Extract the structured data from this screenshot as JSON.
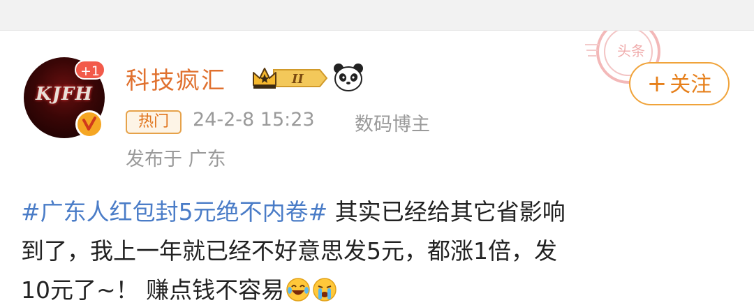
{
  "user": {
    "name": "科技疯汇",
    "avatar_text": "KJFH",
    "notification_badge": "+1",
    "level_badge": "II"
  },
  "follow_button": {
    "plus": "+",
    "label": "关注"
  },
  "meta": {
    "hot_tag": "热门",
    "time": "24-2-8 15:23",
    "category": "数码博主",
    "location": "发布于 广东"
  },
  "post": {
    "hashtag": "#广东人红包封5元绝不内卷#",
    "line1_rest": " 其实已经给其它省影响",
    "line2": "到了，我上一年就已经不好意思发5元，都涨1倍，发",
    "line3": "10元了~！ 赚点钱不容易",
    "emojis": [
      "laugh-cry-emoji",
      "crying-emoji"
    ]
  },
  "stamp_text": "头条",
  "colors": {
    "username": "#e0712f",
    "hashtag": "#4a7cc7",
    "follow_border": "#f0a33a",
    "meta_gray": "#9a9a9a",
    "badge_red": "#f25a4a"
  }
}
